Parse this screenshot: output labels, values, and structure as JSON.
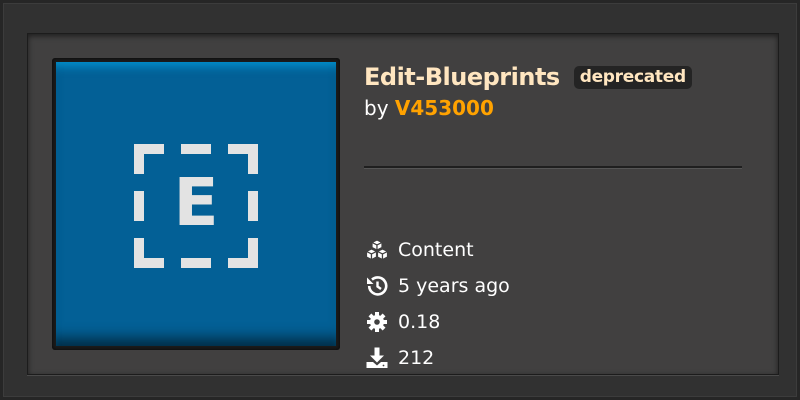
{
  "mod": {
    "title": "Edit-Blueprints",
    "badge": "deprecated",
    "by_label": "by",
    "author": "V453000",
    "thumbnail_icon": "dashed-frame-letter-e-icon",
    "thumbnail_letter": "E"
  },
  "stats": [
    {
      "icon": "cubes-icon",
      "label": "Content"
    },
    {
      "icon": "history-icon",
      "label": "5 years ago"
    },
    {
      "icon": "gear-icon",
      "label": "0.18"
    },
    {
      "icon": "download-icon",
      "label": "212"
    }
  ],
  "colors": {
    "thumbnail_bg": "#036096",
    "title": "#ffe6c0",
    "author": "#ffa200",
    "card_bg": "#414040",
    "text": "#ffffff"
  }
}
